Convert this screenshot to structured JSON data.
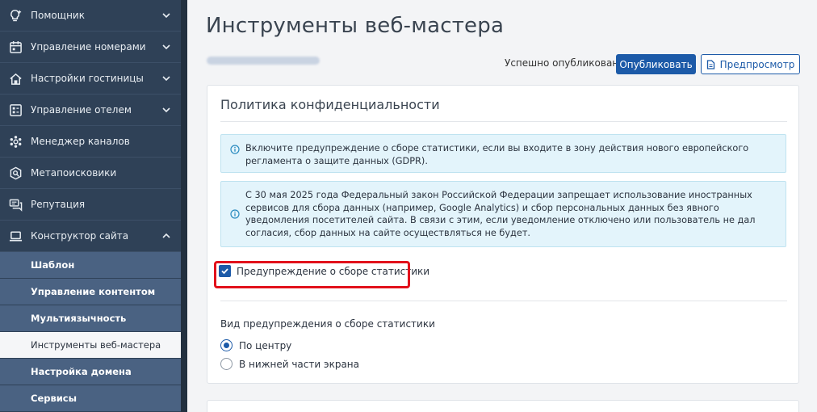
{
  "sidebar": {
    "items": [
      {
        "label": "Помощник",
        "icon": "lightbulb-icon",
        "chevron": "down"
      },
      {
        "label": "Управление номерами",
        "icon": "calendar-icon",
        "chevron": "down"
      },
      {
        "label": "Настройки гостиницы",
        "icon": "home-settings-icon",
        "chevron": "down"
      },
      {
        "label": "Управление отелем",
        "icon": "grid-panel-icon",
        "chevron": "down"
      },
      {
        "label": "Менеджер каналов",
        "icon": "network-icon",
        "chevron": null
      },
      {
        "label": "Метапоисковики",
        "icon": "search-icon",
        "chevron": null
      },
      {
        "label": "Репутация",
        "icon": "comments-icon",
        "chevron": null
      },
      {
        "label": "Конструктор сайта",
        "icon": "laptop-icon",
        "chevron": "up"
      }
    ],
    "subitems": [
      {
        "label": "Шаблон"
      },
      {
        "label": "Управление контентом"
      },
      {
        "label": "Мультиязычность"
      },
      {
        "label": "Инструменты веб-мастера",
        "active": true
      },
      {
        "label": "Настройка домена"
      },
      {
        "label": "Сервисы"
      }
    ]
  },
  "header": {
    "title": "Инструменты веб-мастера",
    "status": "Успешно опубликовано",
    "publish_label": "Опубликовать",
    "preview_label": "Предпросмотр"
  },
  "privacy": {
    "title": "Политика конфиденциальности",
    "info1": "Включите предупреждение о сборе статистики, если вы входите в зону действия нового европейского регламента о защите данных (GDPR).",
    "info2": "С 30 мая 2025 года Федеральный закон Российской Федерации запрещает использование иностранных сервисов для сбора данных (например, Google Analytics) и сбор персональных данных без явного уведомления посетителей сайта. В связи с этим, если уведомление отключено или пользователь не дал согласия, сбор данных на сайте осуществляться не будет.",
    "checkbox_label": "Предупреждение о сборе статистики",
    "checkbox_checked": true,
    "radio_title": "Вид предупреждения о сборе статистики",
    "radio_options": [
      {
        "label": "По центру",
        "selected": true
      },
      {
        "label": "В нижней части экрана",
        "selected": false
      }
    ]
  },
  "colors": {
    "sidebar": "#2f4157",
    "submenu": "#4a6282",
    "accent": "#1c5aa8",
    "info_bg": "#e3f4fb",
    "highlight": "#e2111b"
  }
}
